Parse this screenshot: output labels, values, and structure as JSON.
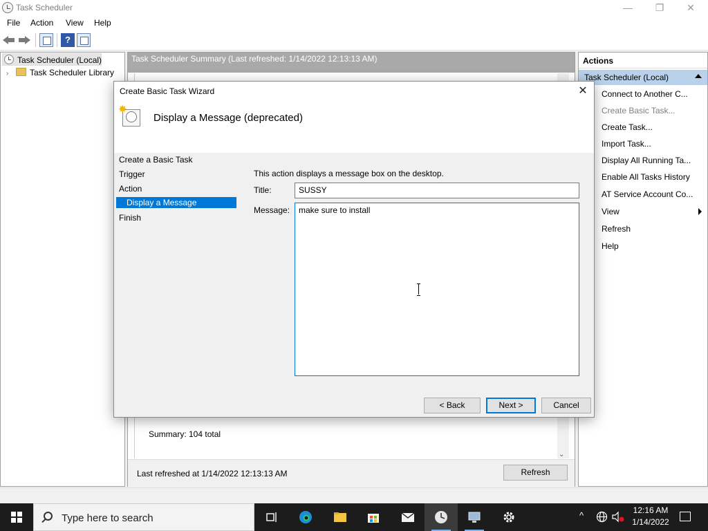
{
  "window": {
    "title": "Task Scheduler",
    "controls": {
      "minimize": "—",
      "restore": "❐",
      "close": "✕"
    }
  },
  "menu": [
    "File",
    "Action",
    "View",
    "Help"
  ],
  "tree": {
    "root": "Task Scheduler (Local)",
    "library": "Task Scheduler Library"
  },
  "center": {
    "header": "Task Scheduler Summary (Last refreshed: 1/14/2022 12:13:13 AM)",
    "summary_total": "Summary: 104 total",
    "last_refreshed": "Last refreshed at 1/14/2022 12:13:13 AM",
    "refresh_button": "Refresh"
  },
  "actions": {
    "header": "Actions",
    "section": "Task Scheduler (Local)",
    "items": [
      {
        "label": "Connect to Another C...",
        "disabled": false
      },
      {
        "label": "Create Basic Task...",
        "disabled": true
      },
      {
        "label": "Create Task...",
        "disabled": false
      },
      {
        "label": "Import Task...",
        "disabled": false
      },
      {
        "label": "Display All Running Ta...",
        "disabled": false
      },
      {
        "label": "Enable All Tasks History",
        "disabled": false
      },
      {
        "label": "AT Service Account Co...",
        "disabled": false
      },
      {
        "label": "View",
        "disabled": false
      },
      {
        "label": "Refresh",
        "disabled": false
      },
      {
        "label": "Help",
        "disabled": false
      }
    ]
  },
  "dialog": {
    "title": "Create Basic Task Wizard",
    "close": "✕",
    "heading": "Display a Message (deprecated)",
    "steps": [
      "Create a Basic Task",
      "Trigger",
      "Action",
      "Display a Message",
      "Finish"
    ],
    "active_step": "Display a Message",
    "description": "This action displays a message box on the desktop.",
    "title_label": "Title:",
    "title_value": "SUSSY",
    "message_label": "Message:",
    "message_value": "make sure to install",
    "back_button": "< Back",
    "next_button": "Next >",
    "cancel_button": "Cancel"
  },
  "taskbar": {
    "search_placeholder": "Type here to search",
    "time": "12:16 AM",
    "date": "1/14/2022"
  },
  "colors": {
    "accent": "#0078d7",
    "selection": "#b9d1ea",
    "taskbar": "#1c1c1c"
  }
}
